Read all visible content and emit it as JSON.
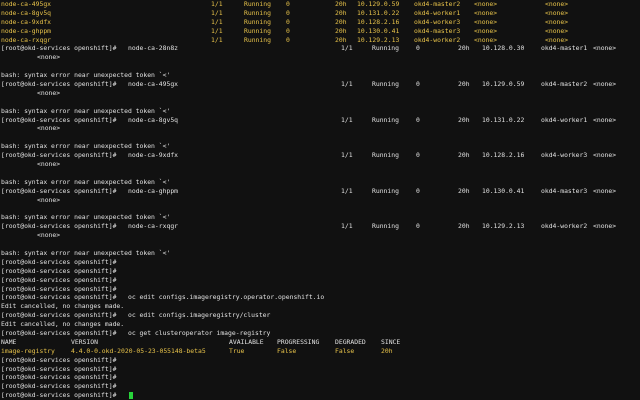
{
  "top_rows": [
    [
      "node-ca-495gx",
      "1/1",
      "Running",
      "0",
      "20h",
      "10.129.0.59",
      "okd4-master2",
      "<none>",
      "<none>"
    ],
    [
      "node-ca-8gv5q",
      "1/1",
      "Running",
      "0",
      "20h",
      "10.131.0.22",
      "okd4-worker1",
      "<none>",
      "<none>"
    ],
    [
      "node-ca-9xdfx",
      "1/1",
      "Running",
      "0",
      "20h",
      "10.128.2.16",
      "okd4-worker3",
      "<none>",
      "<none>"
    ],
    [
      "node-ca-ghppm",
      "1/1",
      "Running",
      "0",
      "20h",
      "10.130.0.41",
      "okd4-master3",
      "<none>",
      "<none>"
    ],
    [
      "node-ca-rxqgr",
      "1/1",
      "Running",
      "0",
      "20h",
      "10.129.2.13",
      "okd4-worker2",
      "<none>",
      "<none>"
    ]
  ],
  "prompt": "[root@okd-services openshift]#",
  "error_text": "bash: syntax error near unexpected token `<'",
  "err_cmds": [
    {
      "node": "node-ca-28n8z",
      "row": [
        "1/1",
        "Running",
        "0",
        "20h",
        "10.128.0.30",
        "okd4-master1",
        "<none>"
      ],
      "none": "<none>"
    },
    {
      "node": "node-ca-495gx",
      "row": [
        "1/1",
        "Running",
        "0",
        "20h",
        "10.129.0.59",
        "okd4-master2",
        "<none>"
      ],
      "none": "<none>"
    },
    {
      "node": "node-ca-8gv5q",
      "row": [
        "1/1",
        "Running",
        "0",
        "20h",
        "10.131.0.22",
        "okd4-worker1",
        "<none>"
      ],
      "none": "<none>"
    },
    {
      "node": "node-ca-9xdfx",
      "row": [
        "1/1",
        "Running",
        "0",
        "20h",
        "10.128.2.16",
        "okd4-worker3",
        "<none>"
      ],
      "none": "<none>"
    },
    {
      "node": "node-ca-ghppm",
      "row": [
        "1/1",
        "Running",
        "0",
        "20h",
        "10.130.0.41",
        "okd4-master3",
        "<none>"
      ],
      "none": "<none>"
    },
    {
      "node": "node-ca-rxqgr",
      "row": [
        "1/1",
        "Running",
        "0",
        "20h",
        "10.129.2.13",
        "okd4-worker2",
        "<none>"
      ],
      "none": "<none>"
    }
  ],
  "cmd_edit1": "oc edit configs.imageregistry.operator.openshift.io",
  "edit_cancelled": "Edit cancelled, no changes made.",
  "cmd_edit2": "oc edit configs.imageregistry/cluster",
  "cmd_get": "oc get clusteroperator image-registry",
  "table_headers": [
    "NAME",
    "VERSION",
    "AVAILABLE",
    "PROGRESSING",
    "DEGRADED",
    "SINCE"
  ],
  "table_row": [
    "image-registry",
    "4.4.0-0.okd-2020-05-23-055148-beta5",
    "True",
    "False",
    "False",
    "20h"
  ],
  "colors": {
    "background": "#111111",
    "text": "#e2e2e2",
    "output": "#e8c34a",
    "cursor": "#27d33a"
  }
}
